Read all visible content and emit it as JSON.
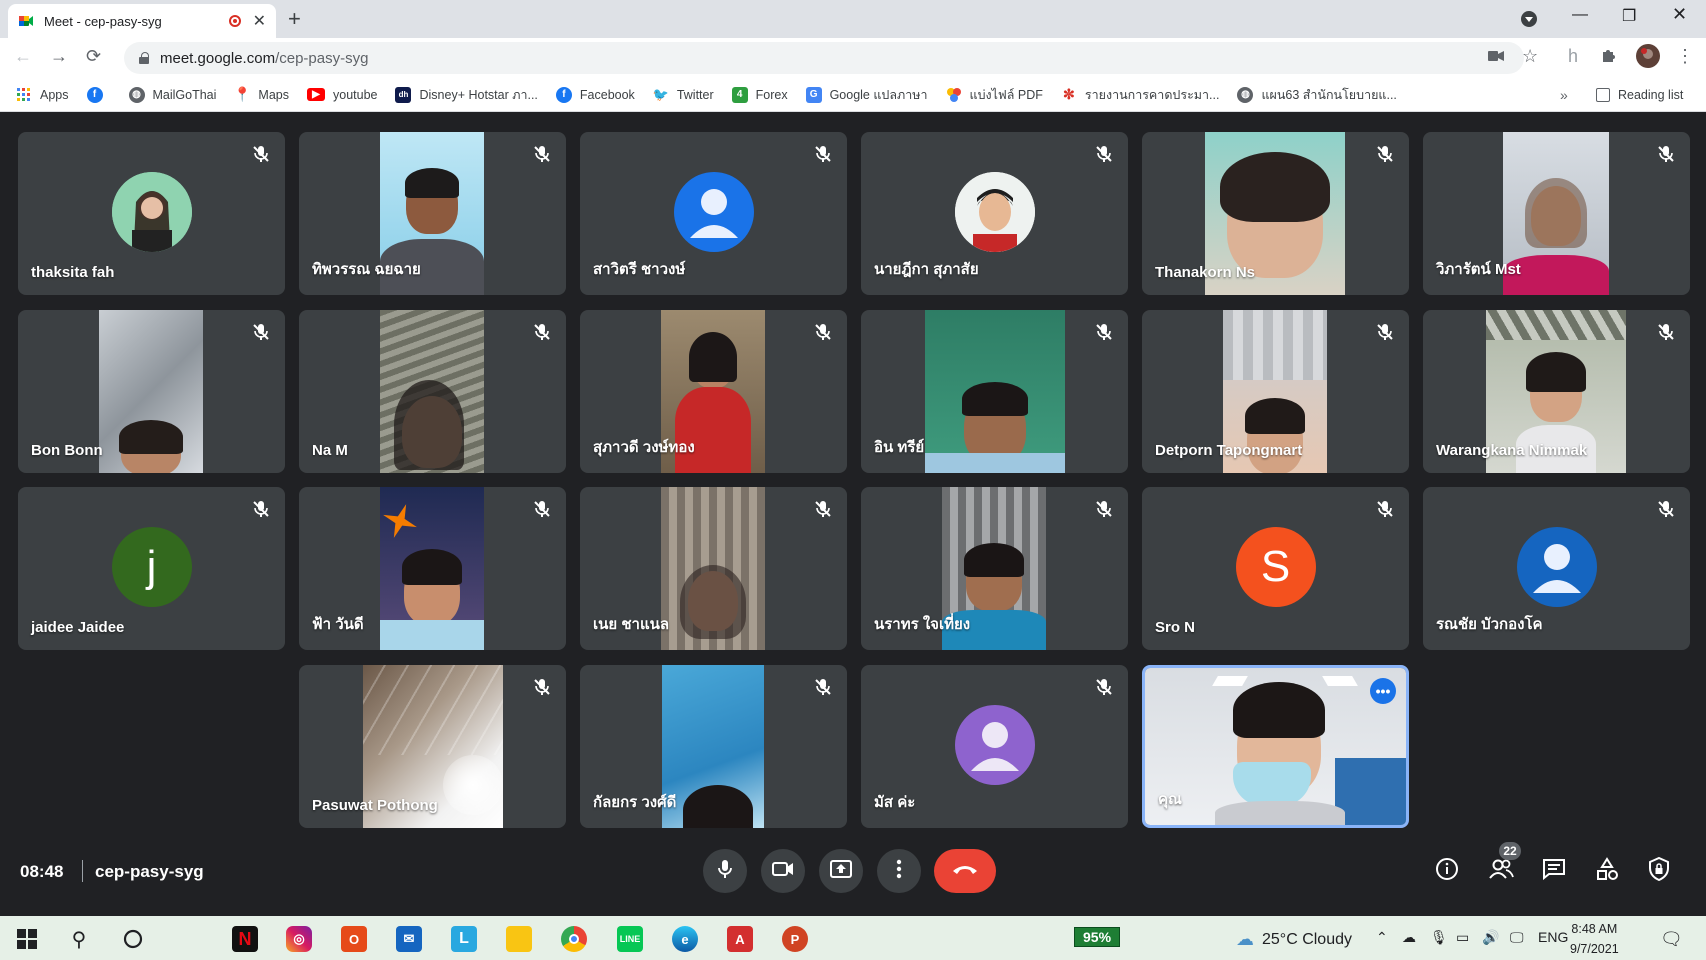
{
  "browser": {
    "tab_title": "Meet - cep-pasy-syg",
    "url_host": "meet.google.com",
    "url_path": "/cep-pasy-syg"
  },
  "bookmarks": [
    {
      "label": "Apps",
      "icon": "apps-grid-icon",
      "color": "#4285f4"
    },
    {
      "label": "",
      "icon": "facebook-icon",
      "color": "#1877f2"
    },
    {
      "label": "MailGoThai",
      "icon": "globe-icon",
      "color": "#5f6368"
    },
    {
      "label": "Maps",
      "icon": "maps-pin-icon",
      "color": "#34a853"
    },
    {
      "label": "youtube",
      "icon": "youtube-icon",
      "color": "#ff0000"
    },
    {
      "label": "Disney+ Hotstar ภา...",
      "icon": "hotstar-icon",
      "color": "#0f1b4c"
    },
    {
      "label": "Facebook",
      "icon": "facebook-icon",
      "color": "#1877f2"
    },
    {
      "label": "Twitter",
      "icon": "twitter-icon",
      "color": "#1da1f2"
    },
    {
      "label": "Forex",
      "icon": "forex-icon",
      "color": "#2e9e3f"
    },
    {
      "label": "Google แปลภาษา",
      "icon": "translate-icon",
      "color": "#4285f4"
    },
    {
      "label": "แบ่งไฟล์ PDF",
      "icon": "pdf-split-icon",
      "color": "#fbbc04"
    },
    {
      "label": "รายงานการคาดประมา...",
      "icon": "dots-icon",
      "color": "#d93025"
    },
    {
      "label": "แผน63 สำนักนโยบายแ...",
      "icon": "globe-icon",
      "color": "#5f6368"
    }
  ],
  "reading_list": "Reading list",
  "participants": [
    {
      "name": "thaksita fah",
      "kind": "photo-avatar"
    },
    {
      "name": "ทิพวรรณ ฉยฉาย",
      "kind": "video"
    },
    {
      "name": "สาวิตรี ชาวงษ์",
      "kind": "default-avatar",
      "color": "#1a73e8"
    },
    {
      "name": "นายฎีกา สุภาสัย",
      "kind": "photo-avatar"
    },
    {
      "name": "Thanakorn Ns",
      "kind": "video"
    },
    {
      "name": "วิภารัตน์ Mst",
      "kind": "video"
    },
    {
      "name": "Bon Bonn",
      "kind": "video"
    },
    {
      "name": "Na M",
      "kind": "video"
    },
    {
      "name": "สุภาวดี วงษ์ทอง",
      "kind": "video"
    },
    {
      "name": "อิน ทรีย์",
      "kind": "video"
    },
    {
      "name": "Detporn Tapongmart",
      "kind": "video"
    },
    {
      "name": "Warangkana Nimmak",
      "kind": "video"
    },
    {
      "name": "jaidee Jaidee",
      "kind": "letter-avatar",
      "letter": "j",
      "color": "#33691e"
    },
    {
      "name": "ฟ้า วันดี",
      "kind": "video"
    },
    {
      "name": "เนย ชาแนล",
      "kind": "video"
    },
    {
      "name": "นราทร ใจเที่ยง",
      "kind": "video"
    },
    {
      "name": "Sro N",
      "kind": "letter-avatar",
      "letter": "S",
      "color": "#f4511e"
    },
    {
      "name": "รณชัย บัวกองโค",
      "kind": "default-avatar",
      "color": "#1565c0"
    },
    {
      "name": "Pasuwat Pothong",
      "kind": "video"
    },
    {
      "name": "กัลยกร วงศ์ดี",
      "kind": "video"
    },
    {
      "name": "มัส ค่ะ",
      "kind": "default-avatar",
      "color": "#8e63ce"
    },
    {
      "name": "คุณ",
      "kind": "self-video"
    }
  ],
  "meeting": {
    "time": "08:48",
    "code": "cep-pasy-syg",
    "participant_count": "22"
  },
  "taskbar": {
    "battery": "95%",
    "weather": "25°C  Cloudy",
    "lang": "ENG",
    "time": "8:48 AM",
    "date": "9/7/2021"
  }
}
